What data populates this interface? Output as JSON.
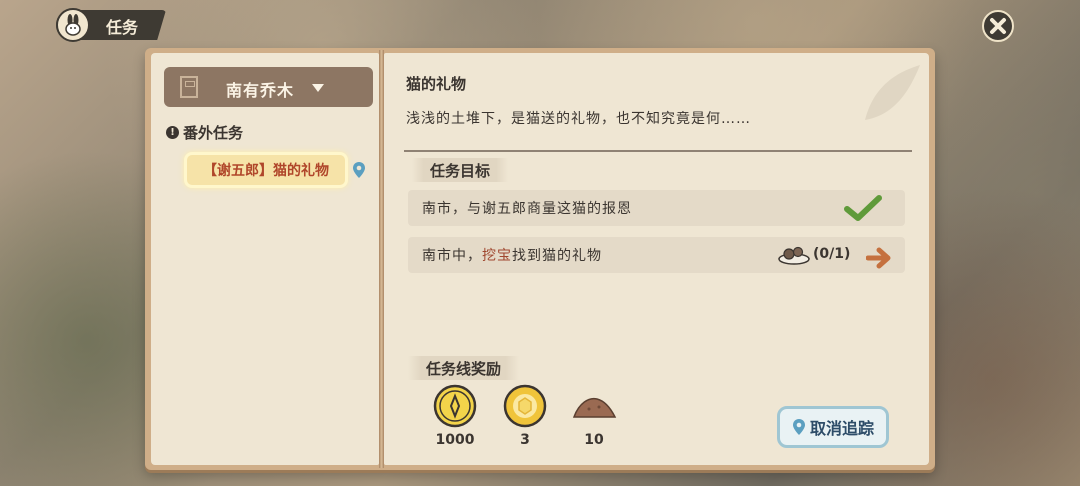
{
  "header": {
    "title": "任务",
    "icon": "rabbit-icon",
    "close_icon": "close-icon"
  },
  "left_page": {
    "region": {
      "label": "南有乔木",
      "icon": "map-region-icon"
    },
    "category": {
      "label": "番外任务",
      "icon": "exclamation-icon"
    },
    "quests": [
      {
        "label": "【谢五郎】猫的礼物",
        "selected": true,
        "tracked": true
      }
    ]
  },
  "right_page": {
    "quest_title": "猫的礼物",
    "quest_description": "浅浅的土堆下，是猫送的礼物，也不知究竟是何……",
    "objectives_header": "任务目标",
    "objectives": [
      {
        "text": "南市，与谢五郎商量这猫的报恩",
        "status": "complete"
      },
      {
        "text_before": "南市中，",
        "text_highlight": "挖宝",
        "text_after": "找到猫的礼物",
        "progress": "(0/1)",
        "status": "in-progress"
      }
    ],
    "rewards_header": "任务线奖励",
    "rewards": [
      {
        "icon": "coin-icon",
        "count": "1000"
      },
      {
        "icon": "gold-token-icon",
        "count": "3"
      },
      {
        "icon": "soil-pile-icon",
        "count": "10"
      }
    ],
    "untrack_button": "取消追踪"
  },
  "colors": {
    "ink": "#3b3530",
    "highlight_red": "#a0472f",
    "check_green": "#5f9a3a",
    "arrow_orange": "#c5713f",
    "button_border": "#9fc6d3"
  }
}
